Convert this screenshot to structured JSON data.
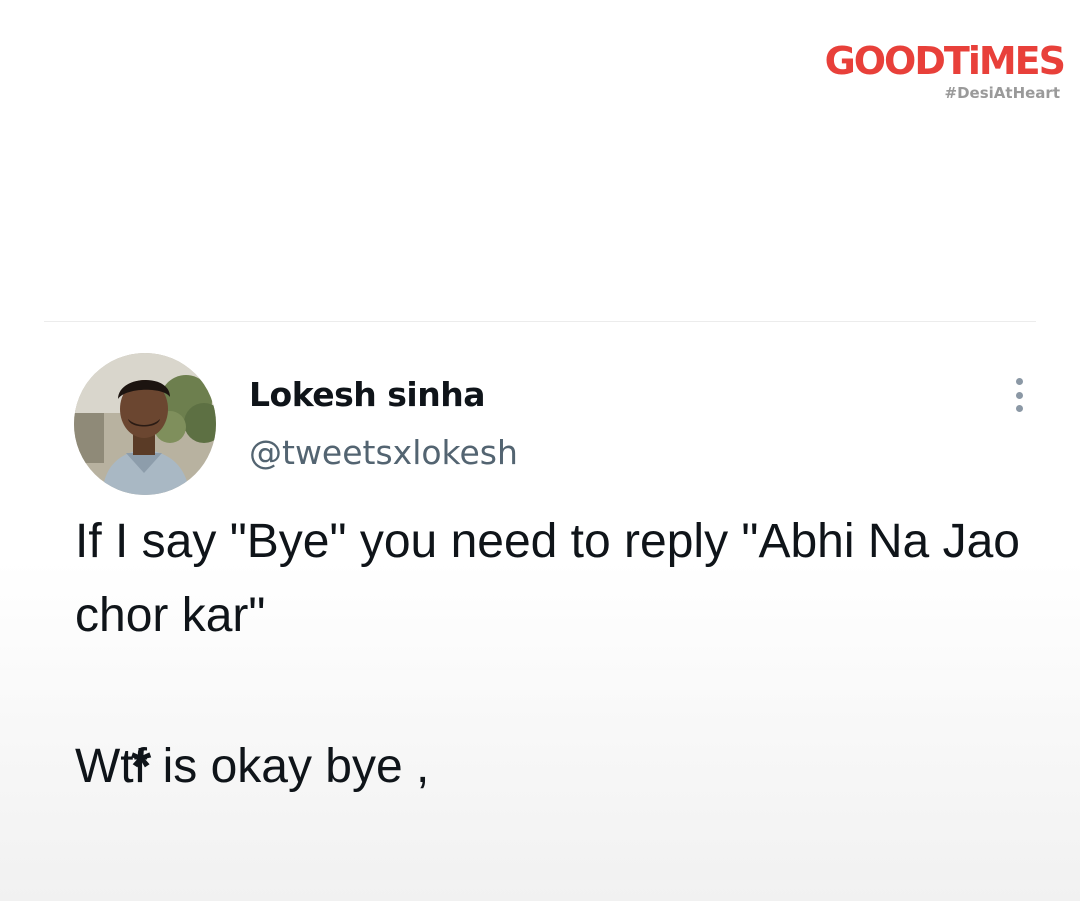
{
  "brand": {
    "logo_text": "GOODTiMES",
    "tagline": "#DesiAtHeart",
    "color": "#e8403a"
  },
  "tweet": {
    "display_name": "Lokesh sinha",
    "handle": "@tweetsxlokesh",
    "text_line_1": "If I say \"Bye\" you need to reply \"Abhi Na Jao chor kar\"",
    "text_line_3_start": "Wtf",
    "censor_mark": "*",
    "text_line_3_end": " is okay bye ,",
    "menu_icon": "more-vertical-icon"
  }
}
